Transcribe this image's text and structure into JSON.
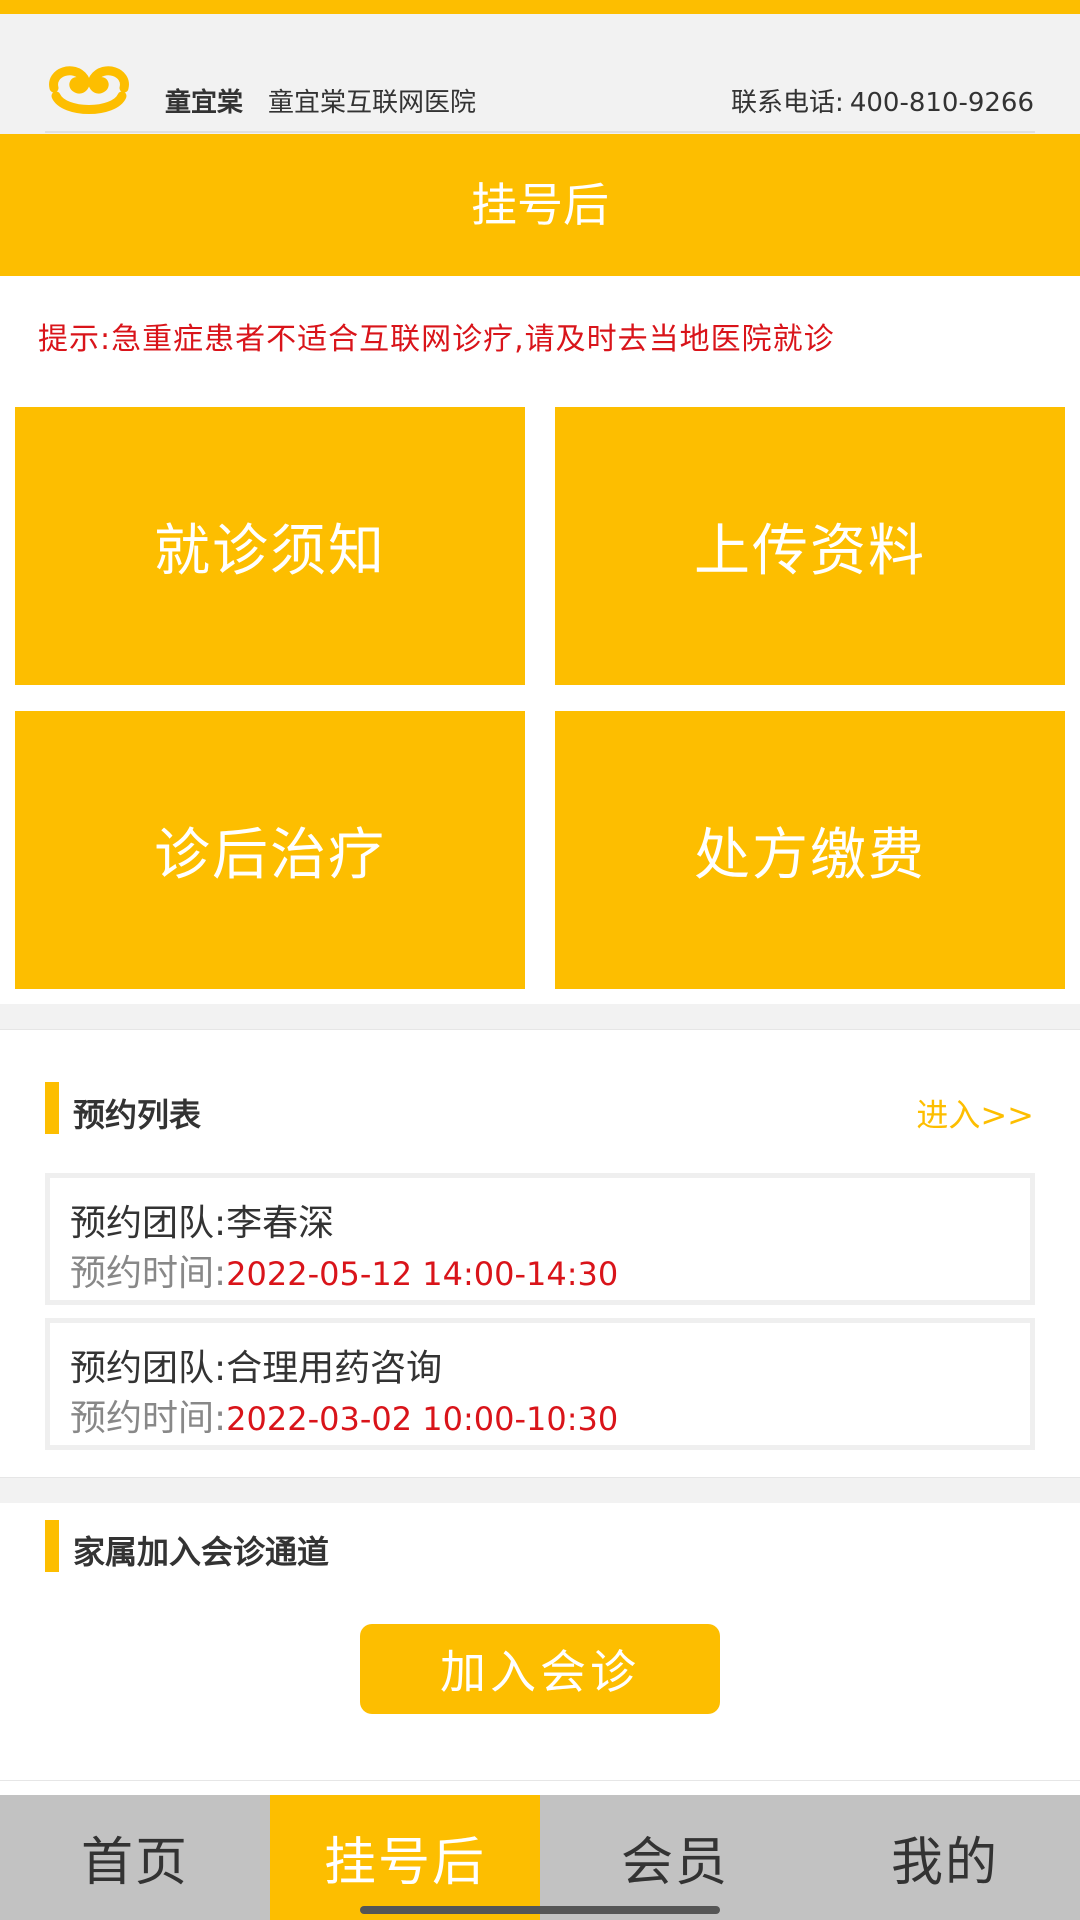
{
  "header": {
    "brand": "童宜棠",
    "hospital": "童宜棠互联网医院",
    "phone_label": "联系电话:",
    "phone_number": "400-810-9266"
  },
  "title_bar": {
    "title": "挂号后"
  },
  "tip": "提示:急重症患者不适合互联网诊疗,请及时去当地医院就诊",
  "tiles": [
    {
      "label": "就诊须知"
    },
    {
      "label": "上传资料"
    },
    {
      "label": "诊后治疗"
    },
    {
      "label": "处方缴费"
    }
  ],
  "appointments": {
    "title": "预约列表",
    "enter_label": "进入>>",
    "items": [
      {
        "team_label": "预约团队:",
        "team": "李春深",
        "time_label": "预约时间:",
        "time": "2022-05-12 14:00-14:30"
      },
      {
        "team_label": "预约团队:",
        "team": "合理用药咨询",
        "time_label": "预约时间:",
        "time": "2022-03-02 10:00-10:30"
      }
    ]
  },
  "family": {
    "title": "家属加入会诊通道",
    "button": "加入会诊"
  },
  "tabbar": {
    "items": [
      {
        "label": "首页",
        "active": false
      },
      {
        "label": "挂号后",
        "active": true
      },
      {
        "label": "会员",
        "active": false
      },
      {
        "label": "我的",
        "active": false
      }
    ]
  },
  "colors": {
    "accent": "#FDBE00",
    "warning_red": "#D9141A",
    "tabbar_bg": "#C2C2C2"
  }
}
